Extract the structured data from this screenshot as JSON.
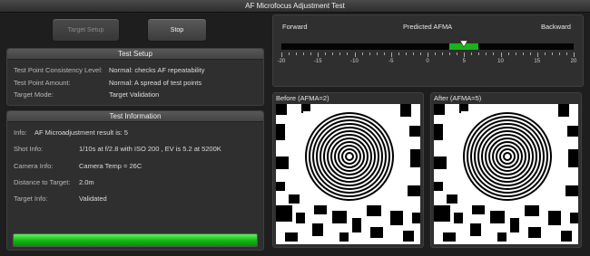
{
  "window": {
    "title": "AF Microfocus Adjustment Test"
  },
  "toolbar": {
    "target_setup_label": "Target Setup",
    "stop_label": "Stop"
  },
  "test_setup": {
    "title": "Test Setup",
    "rows": [
      {
        "label": "Test Point Consistency Level:",
        "value": "Normal: checks AF repeatability"
      },
      {
        "label": "Test Point Amount:",
        "value": "Normal: A spread of test points"
      },
      {
        "label": "Target Mode:",
        "value": "Target Validation"
      }
    ]
  },
  "test_info": {
    "title": "Test Information",
    "rows": [
      {
        "label": "Info:",
        "value": "AF Microadjustment result is: 5"
      },
      {
        "label": "Shot Info:",
        "value": "1/10s at f/2.8 with ISO 200 , EV is 5.2 at 5200K"
      },
      {
        "label": "Camera Info:",
        "value": "Camera Temp = 26C"
      },
      {
        "label": "Distance to Target:",
        "value": "2.0m"
      },
      {
        "label": "Target Info:",
        "value": "Validated"
      }
    ],
    "progress": 1.0
  },
  "afma": {
    "left_label": "Forward",
    "center_label": "Predicted AFMA",
    "right_label": "Backward",
    "min": -20,
    "max": 20,
    "predicted": 5,
    "range_low": 3,
    "range_high": 7,
    "tick_labels": [
      "-20",
      "-15",
      "-10",
      "-5",
      "0",
      "5",
      "10",
      "15",
      "20"
    ]
  },
  "images": {
    "before_caption": "Before (AFMA=2)",
    "after_caption": "After (AFMA=5)"
  },
  "colors": {
    "accent_green": "#17b517",
    "panel_bg": "#2f2f2f"
  }
}
